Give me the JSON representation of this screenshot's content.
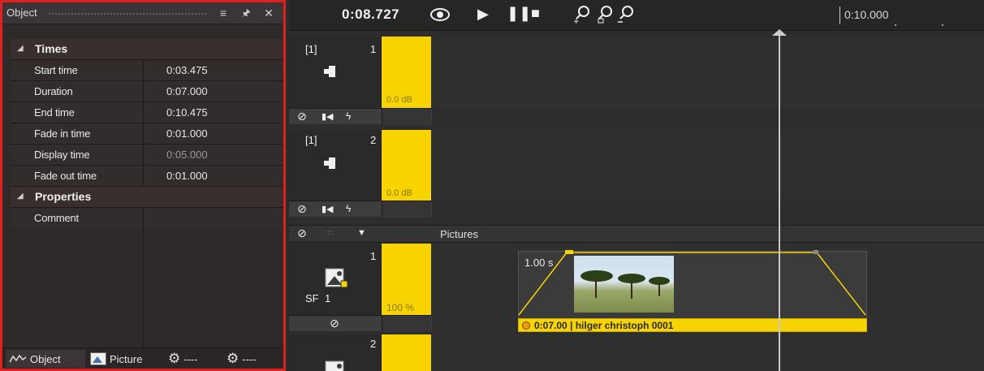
{
  "panel": {
    "title": "Object",
    "buttons": {
      "menu": "≡",
      "pin": "ꟸ",
      "close": "✕"
    },
    "sections": [
      {
        "label": "Times",
        "rows": [
          {
            "key": "Start time",
            "value": "0:03.475"
          },
          {
            "key": "Duration",
            "value": "0:07.000"
          },
          {
            "key": "End time",
            "value": "0:10.475"
          },
          {
            "key": "Fade in time",
            "value": "0:01.000"
          },
          {
            "key": "Display time",
            "value": "0:05.000"
          },
          {
            "key": "Fade out time",
            "value": "0:01.000"
          }
        ]
      },
      {
        "label": "Properties",
        "rows": [
          {
            "key": "Comment",
            "value": ""
          }
        ]
      }
    ],
    "tabs": [
      {
        "label": "Object",
        "icon": "waveform-icon"
      },
      {
        "label": "Picture",
        "icon": "picture-icon"
      },
      {
        "label": "----",
        "icon": "gear-icon"
      },
      {
        "label": "----",
        "icon": "gear-icon"
      }
    ]
  },
  "timeline": {
    "current_time": "0:08.727",
    "ruler_label": "0:10.000",
    "audio_tracks": [
      {
        "group": "[1]",
        "number": "1",
        "level": "0.0 dB"
      },
      {
        "group": "[1]",
        "number": "2",
        "level": "0.0 dB"
      }
    ],
    "pictures_label": "Pictures",
    "picture_tracks": [
      {
        "number": "1",
        "type": "SF",
        "sub": "1",
        "opacity": "100 %"
      },
      {
        "number": "2"
      }
    ],
    "clip": {
      "fade_label": "1.00 s",
      "caption": "0:07.00 | hilger christoph 0001"
    }
  },
  "colors": {
    "accent_yellow": "#f7d400",
    "panel_border": "#e01f1f",
    "background": "#2b2b2b"
  }
}
